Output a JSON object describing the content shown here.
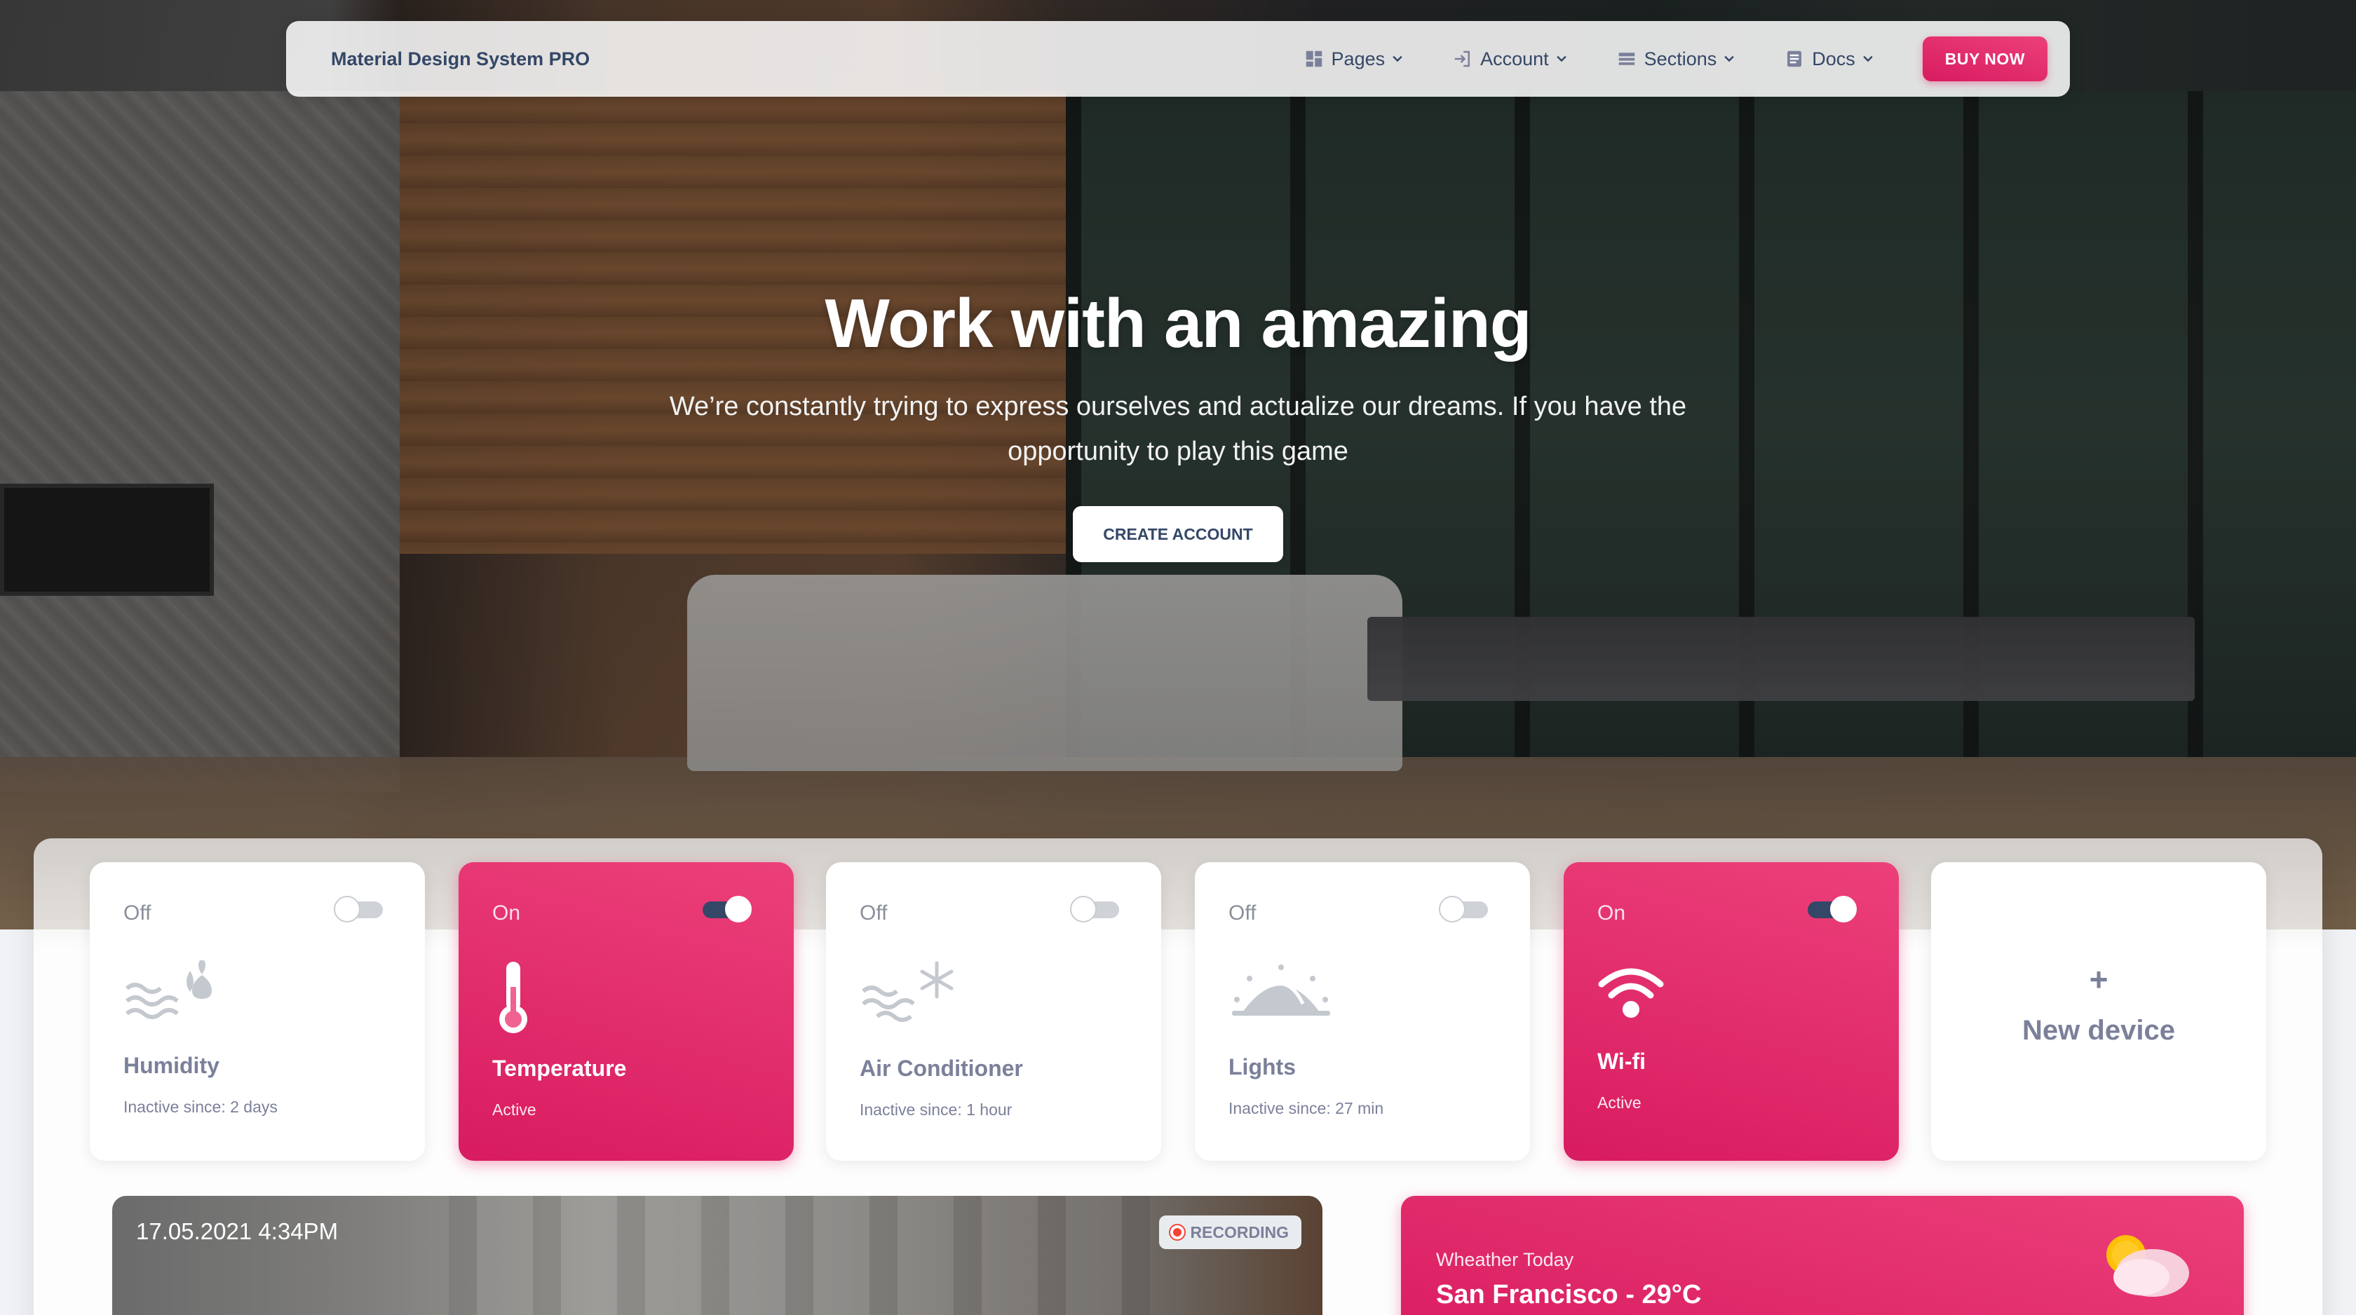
{
  "navbar": {
    "brand": "Material Design System PRO",
    "items": [
      {
        "label": "Pages",
        "icon": "dashboard-icon"
      },
      {
        "label": "Account",
        "icon": "login-icon"
      },
      {
        "label": "Sections",
        "icon": "view-list-icon"
      },
      {
        "label": "Docs",
        "icon": "article-icon"
      }
    ],
    "buy_label": "BUY NOW"
  },
  "hero": {
    "title": "Work with an amazing",
    "subtitle": "We’re constantly trying to express ourselves and actualize our dreams. If you have the opportunity to play this game",
    "cta_label": "CREATE ACCOUNT"
  },
  "devices": [
    {
      "state": "Off",
      "name": "Humidity",
      "since": "Inactive since: 2 days",
      "on": false,
      "icon": "humidity-icon"
    },
    {
      "state": "On",
      "name": "Temperature",
      "since": "Active",
      "on": true,
      "icon": "thermometer-icon"
    },
    {
      "state": "Off",
      "name": "Air Conditioner",
      "since": "Inactive since: 1 hour",
      "on": false,
      "icon": "air-conditioner-icon"
    },
    {
      "state": "Off",
      "name": "Lights",
      "since": "Inactive since: 27 min",
      "on": false,
      "icon": "lights-icon"
    },
    {
      "state": "On",
      "name": "Wi-fi",
      "since": "Active",
      "on": true,
      "icon": "wifi-icon"
    }
  ],
  "new_device": {
    "plus": "+",
    "label": "New device"
  },
  "camera": {
    "timestamp": "17.05.2021 4:34PM",
    "badge": "RECORDING"
  },
  "weather": {
    "label": "Wheather Today",
    "city": "San Francisco - 29°C",
    "icon": "partly-cloudy-icon"
  },
  "colors": {
    "accent": "#e91e63",
    "accent_dark": "#d81b60",
    "text": "#344767",
    "muted": "#7b809a"
  }
}
